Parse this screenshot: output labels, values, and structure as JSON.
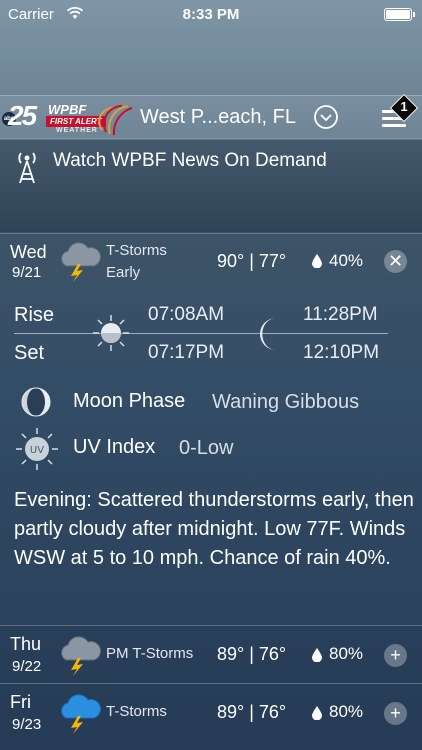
{
  "status_bar": {
    "carrier": "Carrier",
    "time": "8:33 PM"
  },
  "header": {
    "logo": {
      "network": "abc",
      "number": "25",
      "brand": "WPBF",
      "tagline": "FIRST ALERT",
      "sub": "WEATHER"
    },
    "location": "West P...each, FL",
    "menu_badge": "1"
  },
  "news": {
    "label": "Watch WPBF News On Demand"
  },
  "today": {
    "day": "Wed",
    "date": "9/21",
    "condition_line1": "T-Storms",
    "condition_line2": "Early",
    "temps": "90° | 77°",
    "precip": "40%",
    "close_symbol": "✕",
    "icon": "thunderstorm-icon"
  },
  "sun_moon": {
    "rise_label": "Rise",
    "set_label": "Set",
    "sunrise": "07:08AM",
    "sunset": "07:17PM",
    "moonrise": "11:28PM",
    "moonset": "12:10PM"
  },
  "moon_phase": {
    "label": "Moon Phase",
    "value": "Waning Gibbous"
  },
  "uv_index": {
    "label": "UV Index",
    "value": "0-Low",
    "icon_text": "UV"
  },
  "forecast_text": "Evening: Scattered thunderstorms early, then partly cloudy after midnight. Low 77F. Winds WSW at 5 to 10 mph. Chance of rain 40%.",
  "forecast": [
    {
      "day": "Thu",
      "date": "9/22",
      "condition": "PM T-Storms",
      "temps": "89° | 76°",
      "precip": "80%",
      "expand_symbol": "+",
      "icon": "thunderstorm-icon"
    },
    {
      "day": "Fri",
      "date": "9/23",
      "condition": "T-Storms",
      "temps": "89° | 76°",
      "precip": "80%",
      "expand_symbol": "+",
      "icon": "thunderstorm-blue-icon"
    }
  ],
  "colors": {
    "bolt": "#f5b800",
    "storm_cloud": "#8a96a3",
    "storm_cloud_blue": "#2b8fe0",
    "logo_red": "#c8102e"
  }
}
